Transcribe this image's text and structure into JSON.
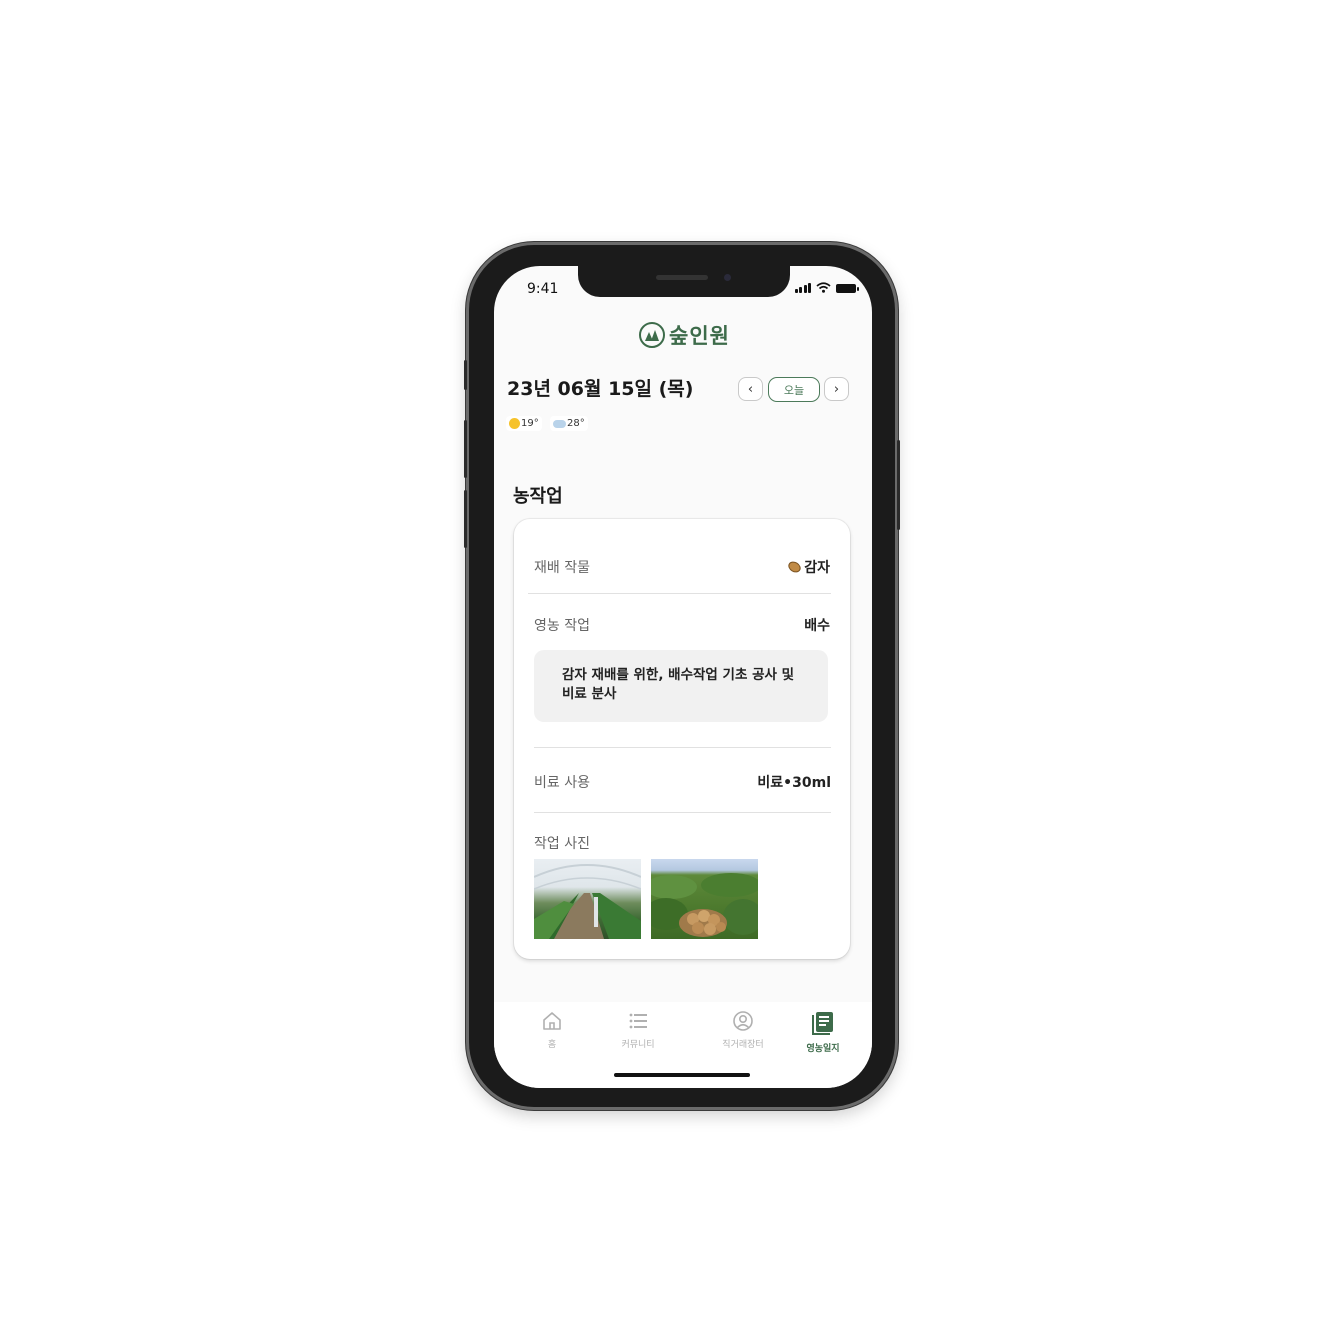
{
  "status_bar": {
    "time": "9:41"
  },
  "app": {
    "logo_text": "숲인원"
  },
  "header": {
    "date": "23년 06월 15일 (목)",
    "prev_label": "‹",
    "today_label": "오늘",
    "next_label": "›",
    "weather": [
      {
        "icon": "sun-icon",
        "temp": "19°"
      },
      {
        "icon": "cloud-icon",
        "temp": "28°"
      }
    ]
  },
  "section": {
    "title": "농작업"
  },
  "card": {
    "crop_label": "재배 작물",
    "crop_value": "감자",
    "work_label": "영농 작업",
    "work_value": "배수",
    "memo": "감자 재배를 위한, 배수작업 기초 공사 및 비료 분사",
    "fertilizer_label": "비료 사용",
    "fertilizer_value": "비료•30ml",
    "photos_label": "작업 사진"
  },
  "tabbar": {
    "items": [
      {
        "label": "홈",
        "icon": "home-icon"
      },
      {
        "label": "커뮤니티",
        "icon": "list-icon"
      },
      {
        "label": "직거래장터",
        "icon": "user-circle-icon"
      },
      {
        "label": "영농일지",
        "icon": "journal-icon",
        "active": true
      }
    ]
  },
  "colors": {
    "brand": "#3d6b4a",
    "inactive": "#b0b0b0"
  }
}
